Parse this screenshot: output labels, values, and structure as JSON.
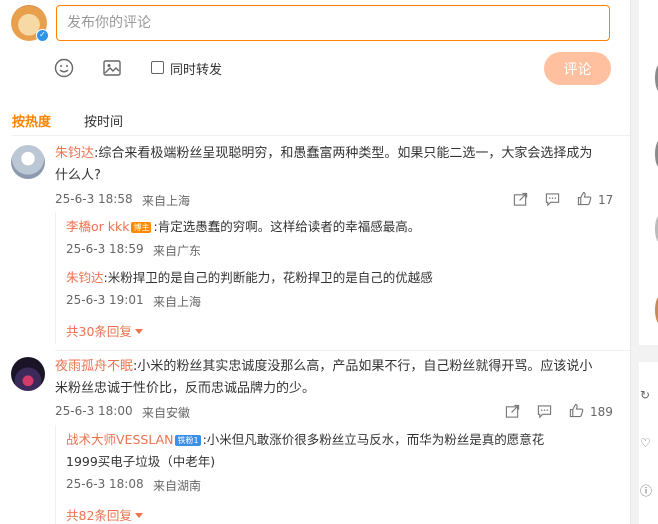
{
  "compose": {
    "placeholder": "发布你的评论",
    "repost_label": "同时转发",
    "submit_label": "评论"
  },
  "sort": {
    "hot": "按热度",
    "time": "按时间"
  },
  "comments": [
    {
      "user": "朱钧达",
      "text_line1": ":综合来看极端粉丝呈现聪明穷，和愚蠢富两种类型。如果只能二选一，大家会选择成为",
      "text_line2": "什么人?",
      "time": "25-6-3 18:58",
      "location": "来自上海",
      "likes": "17",
      "replies": [
        {
          "user": "李橋or kkk",
          "tag": "博主",
          "text": ":肯定选愚蠢的穷啊。这样给读者的幸福感最高。",
          "time": "25-6-3 18:59",
          "location": "来自广东"
        },
        {
          "user": "朱钧达",
          "text": ":米粉捍卫的是自己的判断能力，花粉捍卫的是自己的优越感",
          "time": "25-6-3 19:01",
          "location": "来自上海"
        }
      ],
      "more": "共30条回复"
    },
    {
      "user": "夜雨孤舟不眠",
      "text_line1": ":小米的粉丝其实忠诚度没那么高，产品如果不行，自己粉丝就得开骂。应该说小",
      "text_line2": "米粉丝忠诚于性价比，反而忠诚品牌力的少。",
      "time": "25-6-3 18:00",
      "location": "来自安徽",
      "likes": "189",
      "replies": [
        {
          "user": "战术大师VESSLAN",
          "tag": "铁粉1",
          "text_line1": ":小米但凡敢涨价很多粉丝立马反水，而华为粉丝是真的愿意花",
          "text_line2": "1999买电子垃圾（中老年)",
          "time": "25-6-3 18:08",
          "location": "来自湖南"
        }
      ],
      "more": "共82条回复"
    }
  ],
  "icons": {
    "emoji": "emoji-icon",
    "image": "image-icon",
    "share": "share-icon",
    "comment": "comment-icon",
    "like": "like-icon"
  },
  "colors": {
    "accent": "#ff8200",
    "username": "#eb7350",
    "submit_disabled": "#ffc09f"
  }
}
